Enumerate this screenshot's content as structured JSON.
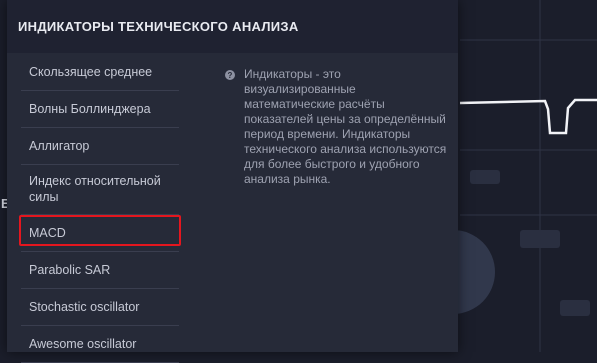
{
  "panel": {
    "title": "ИНДИКАТОРЫ ТЕХНИЧЕСКОГО АНАЛИЗА"
  },
  "indicators": [
    {
      "label": "Скользящее среднее"
    },
    {
      "label": "Волны Боллинджера"
    },
    {
      "label": "Аллигатор"
    },
    {
      "label": "Индекс относительной силы"
    },
    {
      "label": "MACD",
      "selected": true
    },
    {
      "label": "Parabolic SAR"
    },
    {
      "label": "Stochastic oscillator"
    },
    {
      "label": "Awesome oscillator"
    }
  ],
  "info": {
    "icon": "question-circle-icon",
    "text": "Индикаторы - это визуализированные математические расчёты показателей цены за определённый период времени. Индикаторы технического анализа используются для более быстрого и удобного анализа рынка."
  },
  "background": {
    "edge_letter": "E"
  },
  "colors": {
    "highlight": "#e4161e",
    "panel": "#262a38",
    "header": "#1f2231"
  }
}
